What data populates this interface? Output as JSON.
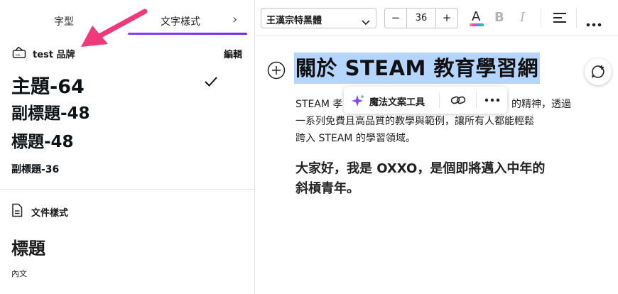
{
  "tabs": {
    "font": "字型",
    "text_styles": "文字樣式"
  },
  "brand": {
    "name": "test 品牌",
    "edit": "編輯"
  },
  "styles": {
    "title": "主題-64",
    "subtitle1": "副標題-48",
    "heading": "標題-48",
    "subtitle2": "副標題-36"
  },
  "document_styles": {
    "label": "文件樣式",
    "heading": "標題",
    "body": "內文"
  },
  "toolbar": {
    "font_name": "王漢宗特黑體",
    "font_size": "36",
    "minus": "−",
    "plus": "+",
    "text_color_letter": "A",
    "bold_letter": "B",
    "italic_letter": "I"
  },
  "document": {
    "heading": "關於 STEAM 教育學習網",
    "paragraph1_start": "STEAM 孝",
    "paragraph1_after_popup": "的精神，透過",
    "paragraph1_line2": "一系列免費且高品質的教學與範例，讓所有人都能輕鬆",
    "paragraph1_line3": "跨入 STEAM 的學習領域。",
    "paragraph2_line1": "大家好，我是 OXXO，是個即將邁入中年的",
    "paragraph2_line2": "斜槓青年。"
  },
  "popup": {
    "magic_label": "魔法文案工具"
  },
  "colors": {
    "accent": "#8b3dff",
    "selection": "#b4d5fe",
    "arrow": "#f0397a"
  }
}
